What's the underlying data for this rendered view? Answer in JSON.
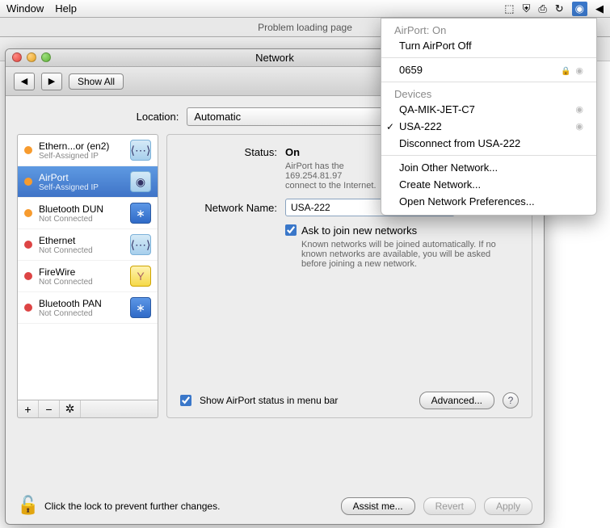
{
  "menubar": {
    "window": "Window",
    "help": "Help"
  },
  "browser": {
    "tab_title": "Problem loading page"
  },
  "window": {
    "title": "Network",
    "back_glyph": "◀",
    "fwd_glyph": "▶",
    "show_all": "Show All",
    "location_label": "Location:",
    "location_value": "Automatic"
  },
  "sidebar": {
    "items": [
      {
        "name": "Ethern...or (en2)",
        "sub": "Self-Assigned IP",
        "dot": "orange",
        "icon": "eth"
      },
      {
        "name": "AirPort",
        "sub": "Self-Assigned IP",
        "dot": "orange",
        "icon": "wifi",
        "selected": true
      },
      {
        "name": "Bluetooth DUN",
        "sub": "Not Connected",
        "dot": "orange",
        "icon": "bt"
      },
      {
        "name": "Ethernet",
        "sub": "Not Connected",
        "dot": "red",
        "icon": "eth"
      },
      {
        "name": "FireWire",
        "sub": "Not Connected",
        "dot": "red",
        "icon": "fw"
      },
      {
        "name": "Bluetooth PAN",
        "sub": "Not Connected",
        "dot": "red",
        "icon": "bt"
      }
    ],
    "toolbar": {
      "add": "+",
      "remove": "−",
      "gear": "✲"
    }
  },
  "details": {
    "status_label": "Status:",
    "status_value": "On",
    "status_desc1": "AirPort has the",
    "status_desc2": "169.254.81.97",
    "status_desc3": "connect to the Internet.",
    "network_name_label": "Network Name:",
    "network_name_value": "USA-222",
    "ask_label": "Ask to join new networks",
    "ask_desc": "Known networks will be joined automatically. If no known networks are available, you will be asked before joining a new network.",
    "show_status_label": "Show AirPort status in menu bar",
    "advanced": "Advanced...",
    "help": "?"
  },
  "footer": {
    "lock_text": "Click the lock to prevent further changes.",
    "assist": "Assist me...",
    "revert": "Revert",
    "apply": "Apply"
  },
  "dropdown": {
    "status": "AirPort: On",
    "turn_off": "Turn AirPort Off",
    "network1": "0659",
    "devices_header": "Devices",
    "device1": "QA-MIK-JET-C7",
    "device2": "USA-222",
    "disconnect": "Disconnect from USA-222",
    "join_other": "Join Other Network...",
    "create": "Create Network...",
    "open_prefs": "Open Network Preferences..."
  }
}
